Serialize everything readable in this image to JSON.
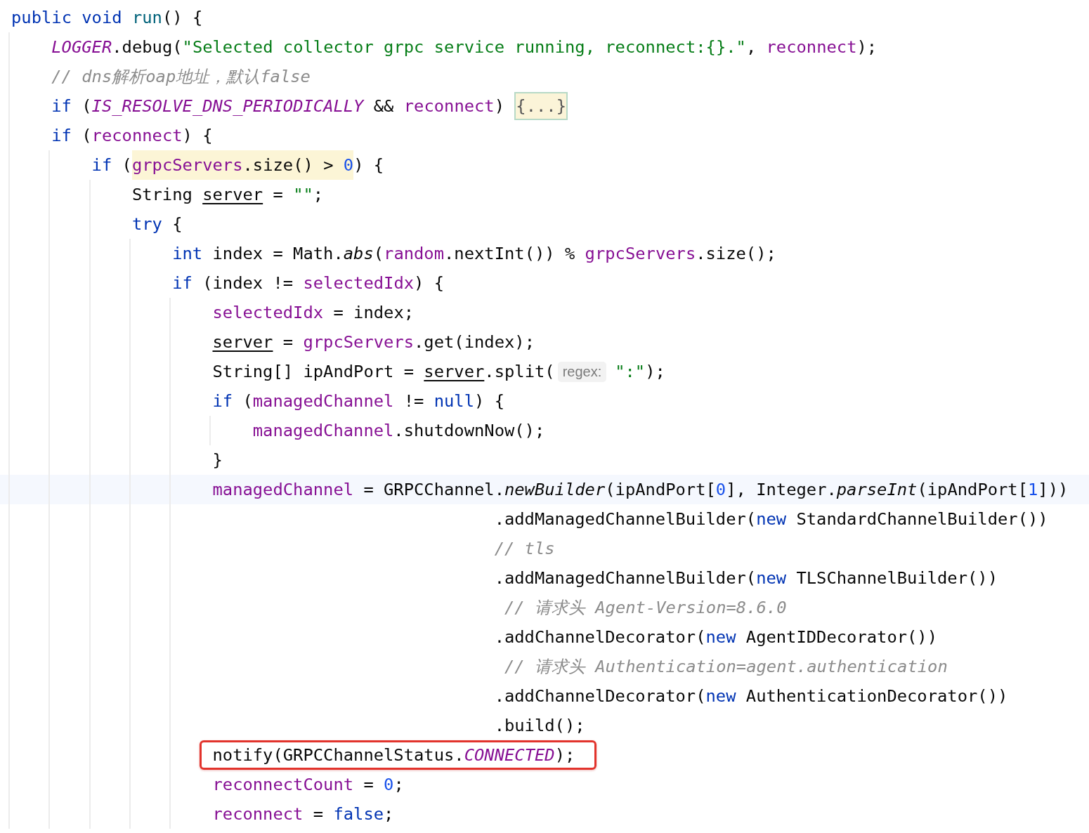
{
  "editor": {
    "lines": [
      {
        "tokens": [
          {
            "text": "public void ",
            "kind": "keyword"
          },
          {
            "text": "run",
            "kind": "declaration"
          },
          {
            "text": "() {",
            "kind": "plain"
          }
        ],
        "children": [
          {
            "tokens": [
              {
                "text": "LOGGER",
                "kind": "constant"
              },
              {
                "text": ".debug(",
                "kind": "plain"
              },
              {
                "text": "\"Selected collector grpc service running, reconnect:{}.\"",
                "kind": "string"
              },
              {
                "text": ", ",
                "kind": "plain"
              },
              {
                "text": "reconnect",
                "kind": "field"
              },
              {
                "text": ");",
                "kind": "plain"
              }
            ]
          },
          {
            "tokens": [
              {
                "text": "// dns解析oap地址，默认false",
                "kind": "comment"
              }
            ]
          },
          {
            "tokens": [
              {
                "text": "if",
                "kind": "keyword"
              },
              {
                "text": " (",
                "kind": "plain"
              },
              {
                "text": "IS_RESOLVE_DNS_PERIODICALLY",
                "kind": "constant"
              },
              {
                "text": " && ",
                "kind": "plain"
              },
              {
                "text": "reconnect",
                "kind": "field"
              },
              {
                "text": ") ",
                "kind": "plain"
              },
              {
                "text": "{...}",
                "kind": "fold"
              }
            ]
          },
          {
            "tokens": [
              {
                "text": "if",
                "kind": "keyword"
              },
              {
                "text": " (",
                "kind": "plain"
              },
              {
                "text": "reconnect",
                "kind": "field"
              },
              {
                "text": ") {",
                "kind": "plain"
              }
            ],
            "children": [
              {
                "tokens": [
                  {
                    "text": "if",
                    "kind": "keyword"
                  },
                  {
                    "text": " (",
                    "kind": "plain"
                  },
                  {
                    "text": "grpcServers",
                    "kind": "field",
                    "highlight": true
                  },
                  {
                    "text": ".size() > ",
                    "kind": "plain",
                    "highlight": true
                  },
                  {
                    "text": "0",
                    "kind": "number",
                    "highlight": true
                  },
                  {
                    "text": ") {",
                    "kind": "plain"
                  }
                ],
                "children": [
                  {
                    "tokens": [
                      {
                        "text": "String ",
                        "kind": "plain"
                      },
                      {
                        "text": "server",
                        "kind": "variable"
                      },
                      {
                        "text": " = ",
                        "kind": "plain"
                      },
                      {
                        "text": "\"\"",
                        "kind": "string"
                      },
                      {
                        "text": ";",
                        "kind": "plain"
                      }
                    ]
                  },
                  {
                    "tokens": [
                      {
                        "text": "try",
                        "kind": "keyword"
                      },
                      {
                        "text": " {",
                        "kind": "plain"
                      }
                    ],
                    "children": [
                      {
                        "tokens": [
                          {
                            "text": "int",
                            "kind": "keyword"
                          },
                          {
                            "text": " index = Math.",
                            "kind": "plain"
                          },
                          {
                            "text": "abs",
                            "kind": "italic"
                          },
                          {
                            "text": "(",
                            "kind": "plain"
                          },
                          {
                            "text": "random",
                            "kind": "field"
                          },
                          {
                            "text": ".nextInt()) % ",
                            "kind": "plain"
                          },
                          {
                            "text": "grpcServers",
                            "kind": "field"
                          },
                          {
                            "text": ".size();",
                            "kind": "plain"
                          }
                        ]
                      },
                      {
                        "tokens": [
                          {
                            "text": "if",
                            "kind": "keyword"
                          },
                          {
                            "text": " (index != ",
                            "kind": "plain"
                          },
                          {
                            "text": "selectedIdx",
                            "kind": "field"
                          },
                          {
                            "text": ") {",
                            "kind": "plain"
                          }
                        ],
                        "children": [
                          {
                            "tokens": [
                              {
                                "text": "selectedIdx",
                                "kind": "field"
                              },
                              {
                                "text": " = index;",
                                "kind": "plain"
                              }
                            ]
                          },
                          {
                            "tokens": [
                              {
                                "text": "server",
                                "kind": "variable"
                              },
                              {
                                "text": " = ",
                                "kind": "plain"
                              },
                              {
                                "text": "grpcServers",
                                "kind": "field"
                              },
                              {
                                "text": ".get(index);",
                                "kind": "plain"
                              }
                            ]
                          },
                          {
                            "tokens": [
                              {
                                "text": "String[] ipAndPort = ",
                                "kind": "plain"
                              },
                              {
                                "text": "server",
                                "kind": "variable"
                              },
                              {
                                "text": ".split(",
                                "kind": "plain"
                              },
                              {
                                "text": "regex:",
                                "kind": "hint"
                              },
                              {
                                "text": "\":\"",
                                "kind": "string"
                              },
                              {
                                "text": ");",
                                "kind": "plain"
                              }
                            ]
                          },
                          {
                            "tokens": [
                              {
                                "text": "if",
                                "kind": "keyword"
                              },
                              {
                                "text": " (",
                                "kind": "plain"
                              },
                              {
                                "text": "managedChannel",
                                "kind": "field"
                              },
                              {
                                "text": " != ",
                                "kind": "plain"
                              },
                              {
                                "text": "null",
                                "kind": "keyword"
                              },
                              {
                                "text": ") {",
                                "kind": "plain"
                              }
                            ],
                            "children": [
                              {
                                "tokens": [
                                  {
                                    "text": "managedChannel",
                                    "kind": "field"
                                  },
                                  {
                                    "text": ".shutdownNow();",
                                    "kind": "plain"
                                  }
                                ]
                              }
                            ]
                          },
                          {
                            "tokens": [
                              {
                                "text": "}",
                                "kind": "plain"
                              }
                            ]
                          },
                          {
                            "current": true,
                            "tokens": [
                              {
                                "text": "managedChannel",
                                "kind": "field"
                              },
                              {
                                "text": " = GRPCChannel.",
                                "kind": "plain"
                              },
                              {
                                "text": "newBuilder",
                                "kind": "italic"
                              },
                              {
                                "text": "(ipAndPort[",
                                "kind": "plain"
                              },
                              {
                                "text": "0",
                                "kind": "number"
                              },
                              {
                                "text": "], Integer.",
                                "kind": "plain"
                              },
                              {
                                "text": "parseInt",
                                "kind": "italic"
                              },
                              {
                                "text": "(ipAndPort[",
                                "kind": "plain"
                              },
                              {
                                "text": "1",
                                "kind": "number"
                              },
                              {
                                "text": "]))",
                                "kind": "plain"
                              }
                            ],
                            "continuation": [
                              {
                                "tokens": [
                                  {
                                    "text": ".addManagedChannelBuilder(",
                                    "kind": "plain"
                                  },
                                  {
                                    "text": "new",
                                    "kind": "keyword"
                                  },
                                  {
                                    "text": " StandardChannelBuilder())",
                                    "kind": "plain"
                                  }
                                ]
                              },
                              {
                                "tokens": [
                                  {
                                    "text": "// tls",
                                    "kind": "comment"
                                  }
                                ]
                              },
                              {
                                "tokens": [
                                  {
                                    "text": ".addManagedChannelBuilder(",
                                    "kind": "plain"
                                  },
                                  {
                                    "text": "new",
                                    "kind": "keyword"
                                  },
                                  {
                                    "text": " TLSChannelBuilder())",
                                    "kind": "plain"
                                  }
                                ]
                              },
                              {
                                "tokens": [
                                  {
                                    "text": " // 请求头 Agent-Version=8.6.0",
                                    "kind": "comment"
                                  }
                                ]
                              },
                              {
                                "tokens": [
                                  {
                                    "text": ".addChannelDecorator(",
                                    "kind": "plain"
                                  },
                                  {
                                    "text": "new",
                                    "kind": "keyword"
                                  },
                                  {
                                    "text": " AgentIDDecorator())",
                                    "kind": "plain"
                                  }
                                ]
                              },
                              {
                                "tokens": [
                                  {
                                    "text": " // 请求头 Authentication=agent.authentication",
                                    "kind": "comment"
                                  }
                                ]
                              },
                              {
                                "tokens": [
                                  {
                                    "text": ".addChannelDecorator(",
                                    "kind": "plain"
                                  },
                                  {
                                    "text": "new",
                                    "kind": "keyword"
                                  },
                                  {
                                    "text": " AuthenticationDecorator())",
                                    "kind": "plain"
                                  }
                                ]
                              },
                              {
                                "tokens": [
                                  {
                                    "text": ".build();",
                                    "kind": "plain"
                                  }
                                ]
                              }
                            ]
                          },
                          {
                            "boxed": true,
                            "tokens": [
                              {
                                "text": "notify(GRPCChannelStatus.",
                                "kind": "plain"
                              },
                              {
                                "text": "CONNECTED",
                                "kind": "constant"
                              },
                              {
                                "text": ");",
                                "kind": "plain"
                              }
                            ]
                          },
                          {
                            "tokens": [
                              {
                                "text": "reconnectCount",
                                "kind": "field"
                              },
                              {
                                "text": " = ",
                                "kind": "plain"
                              },
                              {
                                "text": "0",
                                "kind": "number"
                              },
                              {
                                "text": ";",
                                "kind": "plain"
                              }
                            ]
                          },
                          {
                            "tokens": [
                              {
                                "text": "reconnect",
                                "kind": "field"
                              },
                              {
                                "text": " = ",
                                "kind": "plain"
                              },
                              {
                                "text": "false",
                                "kind": "keyword"
                              },
                              {
                                "text": ";",
                                "kind": "plain"
                              }
                            ]
                          }
                        ]
                      }
                    ]
                  }
                ]
              }
            ]
          }
        ]
      }
    ]
  }
}
